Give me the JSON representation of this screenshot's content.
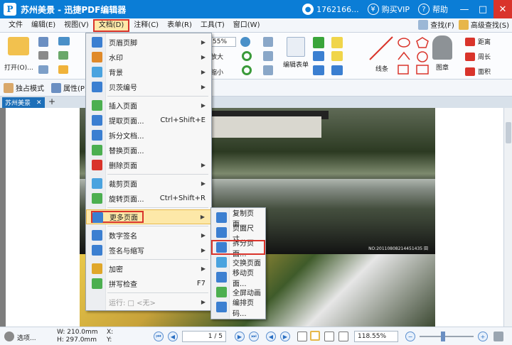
{
  "app": {
    "title": "苏州美景 - 迅捷PDF编辑器",
    "logo": "P",
    "user_phone": "1762166...",
    "buy_vip": "购买VIP",
    "help": "帮助"
  },
  "menubar": {
    "items": [
      "文件",
      "编辑(E)",
      "视图(V)",
      "文档(D)",
      "注释(C)",
      "表单(R)",
      "工具(T)",
      "窗口(W)"
    ],
    "active_index": 3,
    "find": "查找(F)",
    "advanced_find": "高级查找(S)"
  },
  "ribbon": {
    "open": "打开(O)...",
    "zoom_value": "55%",
    "zoom_in_label": "放大",
    "zoom_out_label": "缩小",
    "edit_form": "编辑表单",
    "line": "线条",
    "stamp": "图章",
    "distance": "距离",
    "perimeter": "周长",
    "area": "面积"
  },
  "subbar": {
    "hand_mode": "独占模式",
    "properties": "属性(P)..."
  },
  "tab": {
    "name": "苏州美景"
  },
  "document": {
    "caption": "NO:20110808214451435 田"
  },
  "doc_menu": {
    "items": [
      {
        "label": "页眉页脚",
        "arrow": true,
        "icon_color": "#3b7fd1"
      },
      {
        "label": "水印",
        "arrow": true,
        "icon_color": "#e08a2a"
      },
      {
        "label": "背景",
        "arrow": true,
        "icon_color": "#4aa3df"
      },
      {
        "label": "贝茨编号",
        "arrow": true,
        "icon_color": "#3b7fd1"
      },
      {
        "label": "插入页面",
        "arrow": true,
        "icon_color": "#4caf50"
      },
      {
        "label": "提取页面...",
        "shortcut": "Ctrl+Shift+E",
        "icon_color": "#3b7fd1"
      },
      {
        "label": "拆分文档...",
        "icon_color": "#3b7fd1"
      },
      {
        "label": "替换页面...",
        "icon_color": "#4caf50"
      },
      {
        "label": "删除页面",
        "arrow": true,
        "icon_color": "#d9342b"
      },
      {
        "label": "裁剪页面",
        "arrow": true,
        "icon_color": "#4aa3df"
      },
      {
        "label": "旋转页面...",
        "shortcut": "Ctrl+Shift+R",
        "icon_color": "#4caf50"
      },
      {
        "label": "更多页面",
        "arrow": true,
        "icon_color": "#3b7fd1"
      },
      {
        "label": "数字签名",
        "arrow": true,
        "icon_color": "#3b7fd1"
      },
      {
        "label": "签名与缩写",
        "arrow": true,
        "icon_color": "#3b7fd1"
      },
      {
        "label": "加密",
        "arrow": true,
        "icon_color": "#e0a72a"
      },
      {
        "label": "拼写检查",
        "shortcut": "F7",
        "icon_color": "#4caf50"
      },
      {
        "label": "运行: □ <无>",
        "arrow": true,
        "icon_color": "#cfcfcf"
      }
    ],
    "highlight_index": 11
  },
  "more_pages_menu": {
    "items": [
      {
        "label": "复制页面...",
        "icon_color": "#3b7fd1"
      },
      {
        "label": "页面尺寸...",
        "icon_color": "#3b7fd1"
      },
      {
        "label": "拆分页面...",
        "icon_color": "#3b7fd1"
      },
      {
        "label": "交换页面",
        "icon_color": "#4aa3df"
      },
      {
        "label": "移动页面...",
        "icon_color": "#3b7fd1"
      },
      {
        "label": "全屏动画",
        "icon_color": "#4caf50"
      },
      {
        "label": "编排页码...",
        "icon_color": "#3b7fd1"
      }
    ],
    "boxed_index": 2
  },
  "statusbar": {
    "options": "选项...",
    "width": "W: 210.0mm",
    "height": "H: 297.0mm",
    "x": "X:",
    "y": "Y:",
    "page": "1 / 5",
    "zoom": "118.55%"
  }
}
